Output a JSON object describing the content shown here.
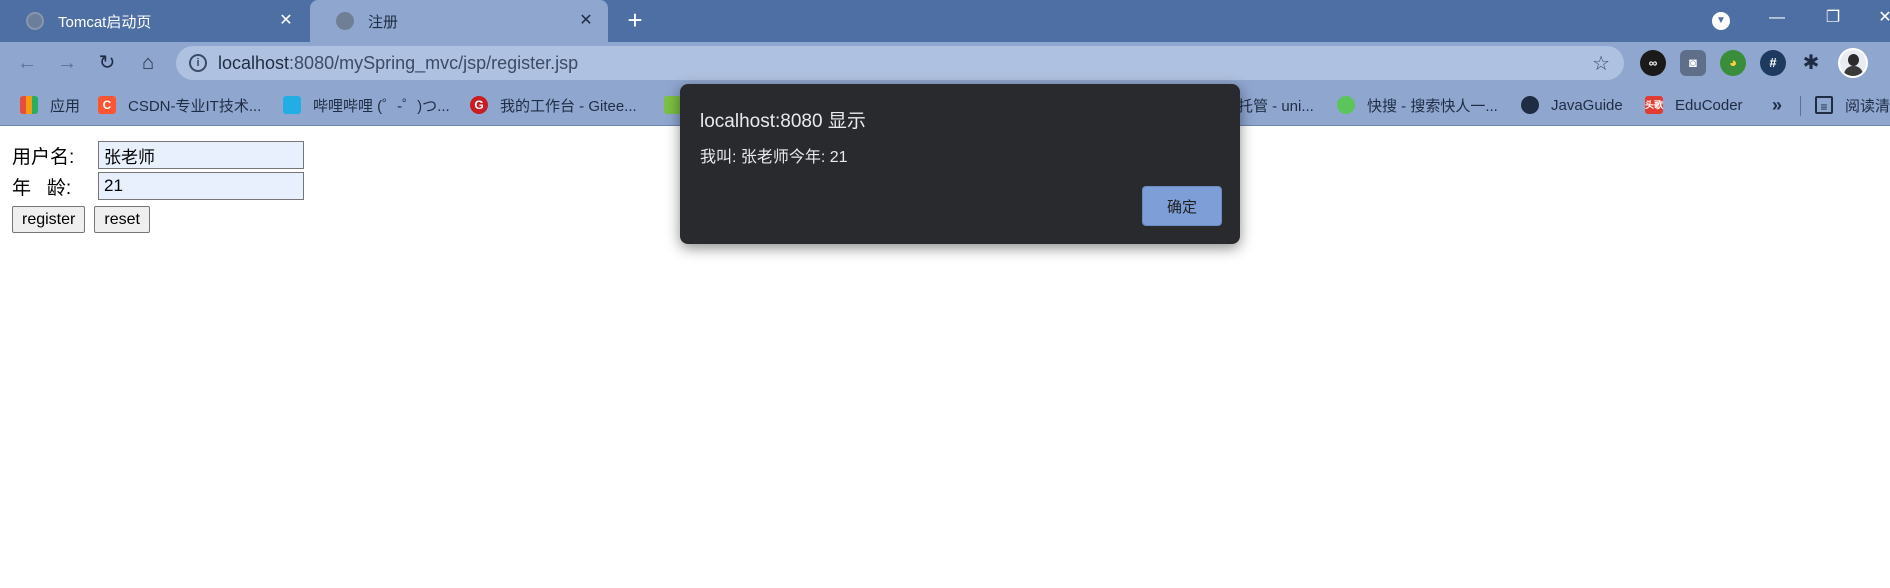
{
  "browser": {
    "tabs": [
      {
        "title": "Tomcat启动页",
        "close": "✕"
      },
      {
        "title": "注册",
        "close": "✕"
      }
    ],
    "new_tab": "+",
    "window": {
      "minimize": "—",
      "maximize": "❐",
      "close": "✕"
    },
    "nav": {
      "back": "←",
      "forward": "→",
      "reload": "↻",
      "home": "⌂"
    },
    "url_host": "localhost",
    "url_path": ":8080/mySpring_mvc/jsp/register.jsp",
    "bookmarks": [
      {
        "label": "应用",
        "icon": "apps-grid-icon"
      },
      {
        "label": "CSDN-专业IT技术...",
        "icon": "csdn-icon",
        "glyph": "C"
      },
      {
        "label": "哔哩哔哩 (゜-゜)つ...",
        "icon": "bilibili-icon"
      },
      {
        "label": "我的工作台 - Gitee...",
        "icon": "gitee-icon",
        "glyph": "G"
      },
      {
        "label": "托管 - uni...",
        "icon": "hidden-icon"
      },
      {
        "label": "快搜 - 搜索快人一...",
        "icon": "kuaisou-icon"
      },
      {
        "label": "JavaGuide",
        "icon": "globe-icon"
      },
      {
        "label": "EduCoder",
        "icon": "educoder-icon",
        "glyph": "头歌"
      },
      {
        "label": "阅读清单",
        "icon": "reading-list-icon"
      }
    ],
    "bookmarks_more": "»"
  },
  "form": {
    "name_label": "用户名:",
    "name_value": "张老师",
    "age_label": "年   龄:",
    "age_value": "21",
    "register_label": "register",
    "reset_label": "reset"
  },
  "dialog": {
    "title": "localhost:8080 显示",
    "message": "我叫: 张老师今年: 21",
    "ok_label": "确定"
  },
  "colors": {
    "tabstrip": "#4e6fa3",
    "toolbar": "#8fa6cf",
    "omnibox": "#afc1e0",
    "dialog_bg": "#292a2d",
    "dialog_button": "#7d9ed6"
  }
}
